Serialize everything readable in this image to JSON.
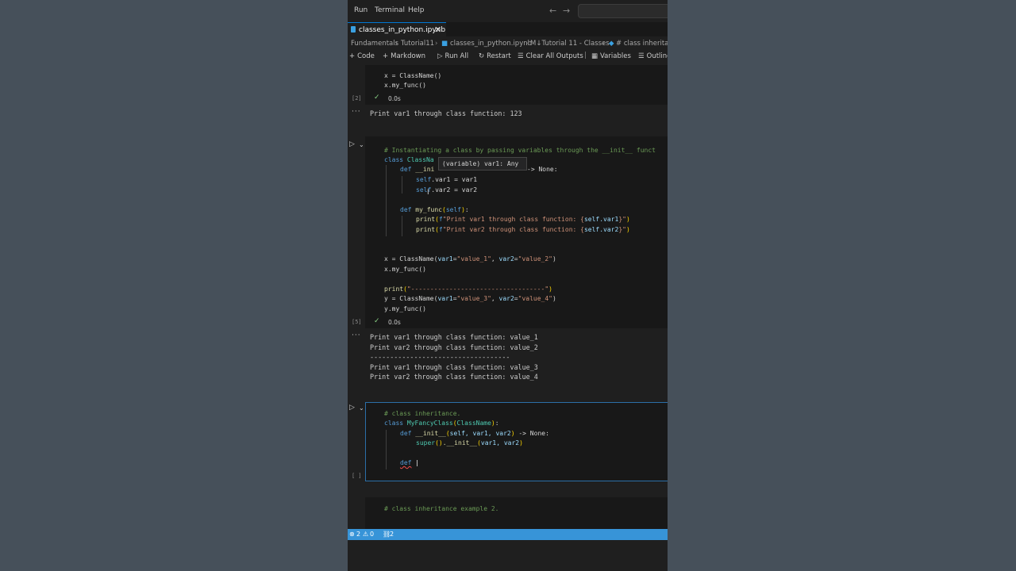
{
  "menu": {
    "run": "Run",
    "terminal": "Terminal",
    "help": "Help"
  },
  "tab": {
    "label": "classes_in_python.ipynb",
    "close": "✕"
  },
  "breadcrumb": {
    "items": [
      "Fundamentals",
      "Tutorial11",
      "classes_in_python.ipynb",
      "M↓Tutorial 11 - Classes",
      "# class inheritan"
    ]
  },
  "toolbar": {
    "code": "Code",
    "markdown": "Markdown",
    "run_all": "Run All",
    "restart": "Restart",
    "clear_all": "Clear All Outputs",
    "variables": "Variables",
    "outline": "Outline"
  },
  "cell1": {
    "lines": [
      "x = ClassName()",
      "x.my_func()"
    ],
    "exec": "[2]",
    "time": "0.0s",
    "output": [
      "Print var1 through class function: 123"
    ]
  },
  "cell2": {
    "comment": "# Instantiating a class by passing variables through the __init__ funct",
    "class_kw": "class",
    "class_name_partial": "ClassNa",
    "def_kw": "def",
    "init_partial": "__ini",
    "arrow_none": "-> None:",
    "self1": "self",
    "assign1": ".var1 = var1",
    "self2": "self",
    "assign2": ".var2 = var2",
    "def_myfunc": "my_func",
    "self_param": "self",
    "print_call": "print",
    "fstr_prefix": "f",
    "str1": "\"Print var1 through class function: {",
    "str1_expr": "self.var1",
    "str1_end": "}\"",
    "str2": "\"Print var2 through class function: {",
    "str2_expr": "self.var2",
    "str2_end": "}\"",
    "inst1_a": "x = ClassName(",
    "inst1_k1": "var1",
    "inst1_v1": "\"value_1\"",
    "inst1_k2": "var2",
    "inst1_v2": "\"value_2\"",
    "call1": "x.my_func()",
    "sep_str": "\"-----------------------------------\"",
    "inst2_a": "y = ClassName(",
    "inst2_k1": "var1",
    "inst2_v1": "\"value_3\"",
    "inst2_k2": "var2",
    "inst2_v2": "\"value_4\"",
    "call2": "y.my_func()",
    "hover": "(variable) var1: Any",
    "exec": "[5]",
    "time": "0.0s",
    "output": [
      "Print var1 through class function: value_1",
      "Print var2 through class function: value_2",
      "-----------------------------------",
      "Print var1 through class function: value_3",
      "Print var2 through class function: value_4"
    ]
  },
  "cell3": {
    "comment": "# class inheritance.",
    "class_kw": "class",
    "class_name": "MyFancyClass",
    "base": "ClassName",
    "def_kw": "def",
    "init": "__init__",
    "params": "self, var1, var2",
    "arrow_none": "-> None:",
    "super_call": "super",
    "init_call": ".__init__",
    "args": "var1, var2",
    "def_partial": "def",
    "exec": "[ ]"
  },
  "cell4": {
    "comment": "# class inheritance example 2."
  },
  "status": {
    "errors": "2",
    "warnings": "0",
    "ports": "2"
  }
}
